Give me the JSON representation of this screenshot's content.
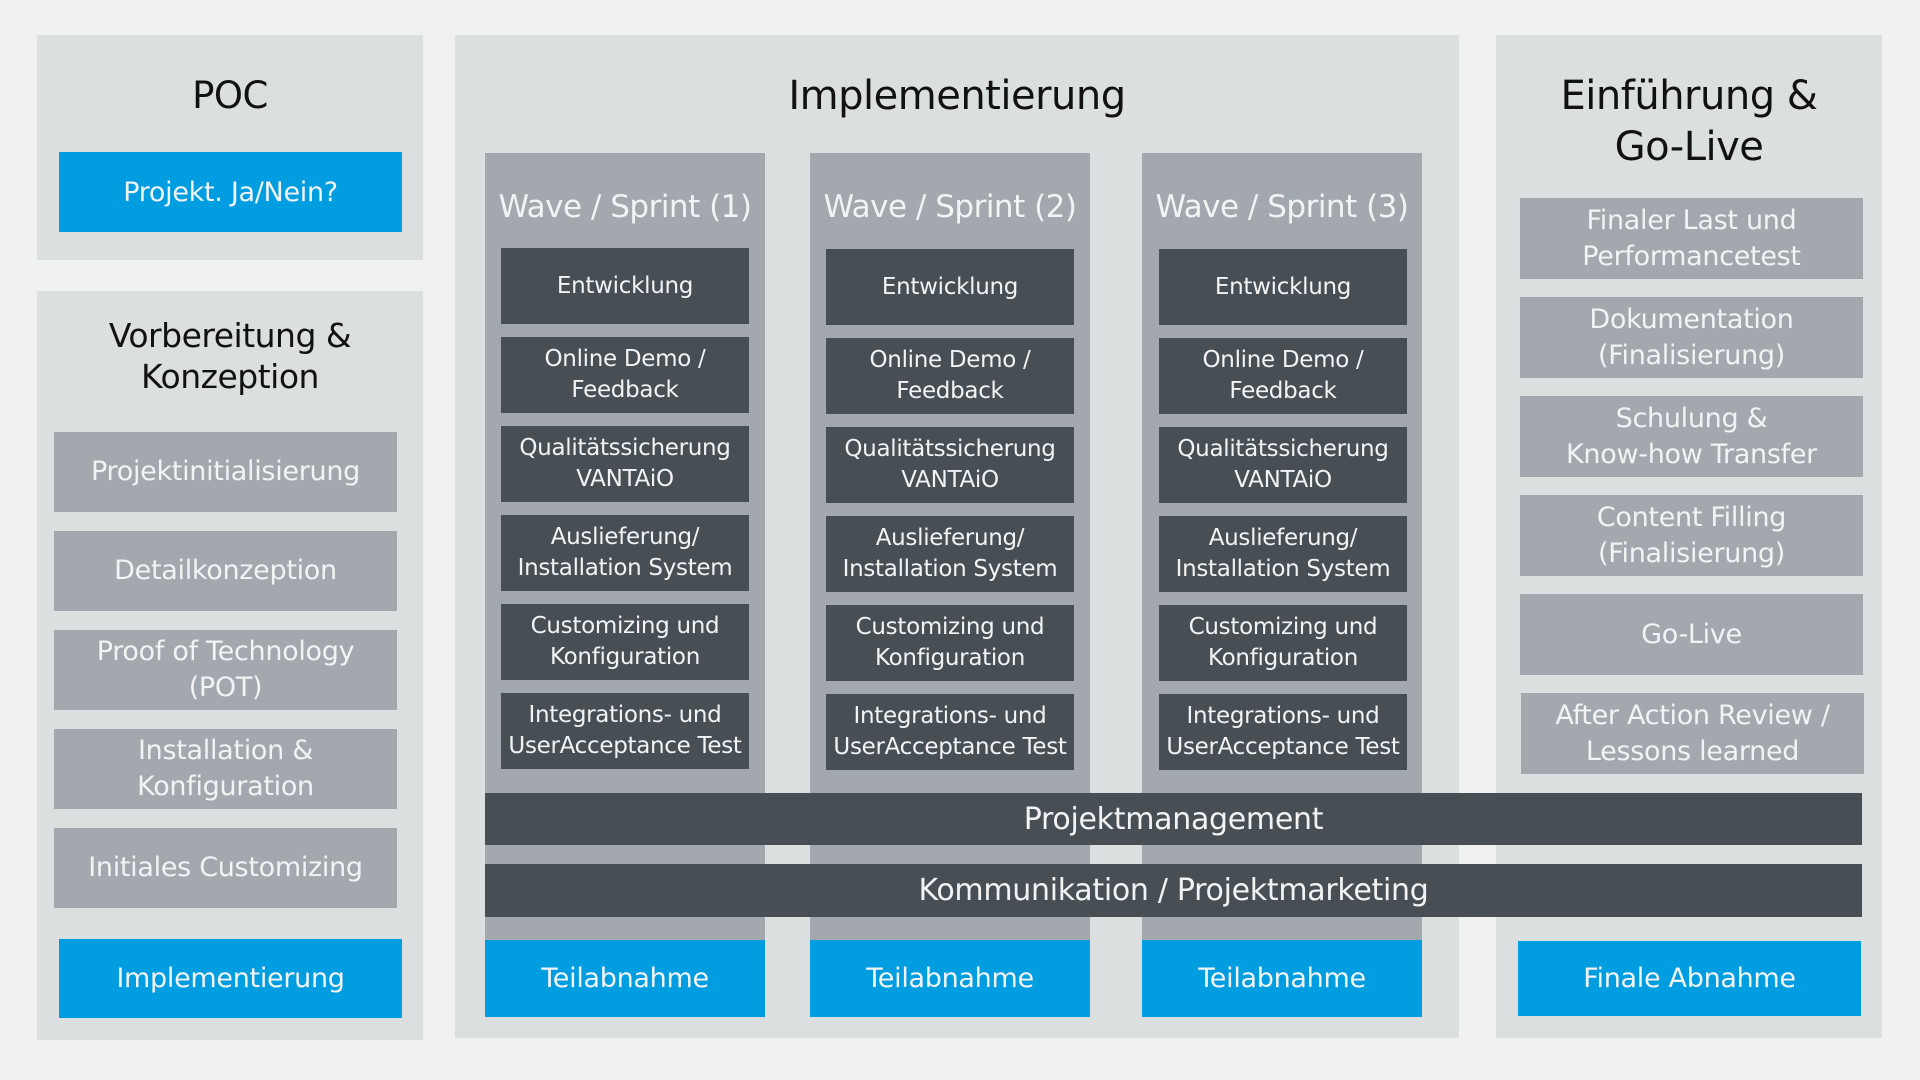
{
  "colors": {
    "accent_blue": "#009ee0",
    "dark_box": "#474e54",
    "light_box": "#a2a8ad",
    "panel": "#dcdfe0",
    "background": "#f0f1f1"
  },
  "poc": {
    "title": "POC",
    "decision": "Projekt. Ja/Nein?"
  },
  "vorbereitung": {
    "title": "Vorbereitung &\nKonzeption",
    "items": [
      "Projektinitialisierung",
      "Detailkonzeption",
      "Proof of Technology\n(POT)",
      "Installation &\nKonfiguration",
      "Initiales Customizing"
    ],
    "milestone": "Implementierung"
  },
  "implementierung": {
    "title": "Implementierung",
    "waves": [
      {
        "title": "Wave / Sprint (1)",
        "items": [
          "Entwicklung",
          "Online Demo /\nFeedback",
          "Qualitätssicherung\nVANTAiO",
          "Auslieferung/\nInstallation System",
          "Customizing und\nKonfiguration",
          "Integrations- und\nUserAcceptance Test"
        ],
        "milestone": "Teilabnahme"
      },
      {
        "title": "Wave / Sprint (2)",
        "items": [
          "Entwicklung",
          "Online Demo /\nFeedback",
          "Qualitätssicherung\nVANTAiO",
          "Auslieferung/\nInstallation System",
          "Customizing und\nKonfiguration",
          "Integrations- und\nUserAcceptance Test"
        ],
        "milestone": "Teilabnahme"
      },
      {
        "title": "Wave / Sprint (3)",
        "items": [
          "Entwicklung",
          "Online Demo /\nFeedback",
          "Qualitätssicherung\nVANTAiO",
          "Auslieferung/\nInstallation System",
          "Customizing und\nKonfiguration",
          "Integrations- und\nUserAcceptance Test"
        ],
        "milestone": "Teilabnahme"
      }
    ]
  },
  "einfuehrung": {
    "title": "Einführung &\nGo-Live",
    "items": [
      "Finaler Last und\nPerformancetest",
      "Dokumentation\n(Finalisierung)",
      "Schulung &\nKnow-how Transfer",
      "Content Filling\n(Finalisierung)",
      "Go-Live",
      "After Action Review /\nLessons learned"
    ],
    "milestone": "Finale Abnahme"
  },
  "crosscutting": {
    "projektmanagement": "Projektmanagement",
    "kommunikation": "Kommunikation / Projektmarketing"
  }
}
